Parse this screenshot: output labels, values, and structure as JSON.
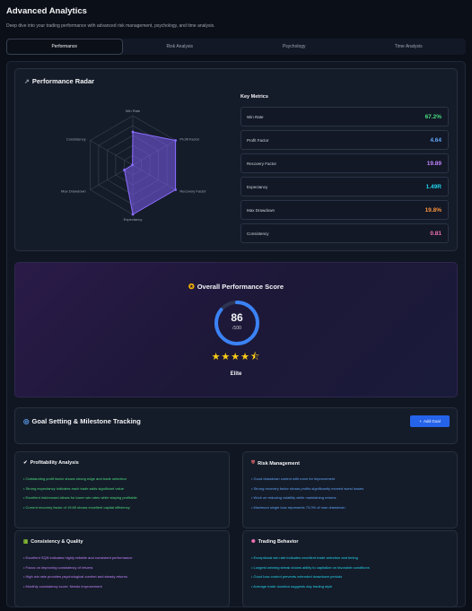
{
  "header": {
    "title": "Advanced Analytics",
    "subtitle": "Deep dive into your trading performance with advanced risk management, psychology, and time analysis."
  },
  "tabs": [
    {
      "label": "Performance",
      "active": true
    },
    {
      "label": "Risk Analysis",
      "active": false
    },
    {
      "label": "Psychology",
      "active": false
    },
    {
      "label": "Time Analysis",
      "active": false
    }
  ],
  "radar": {
    "title": "Performance Radar",
    "icon": "trending-up-icon",
    "axes": [
      "Win Rate",
      "Profit Factor",
      "Recovery Factor",
      "Expectancy",
      "Max Drawdown",
      "Consistency"
    ],
    "values": [
      67.2,
      100,
      100,
      100,
      19.8,
      0.81
    ],
    "fill": "#7c5cf0"
  },
  "metrics": {
    "title": "Key Metrics",
    "rows": [
      {
        "label": "Win Rate",
        "value": "67.2%",
        "color": "#4ade80"
      },
      {
        "label": "Profit Factor",
        "value": "4.64",
        "color": "#60a5fa"
      },
      {
        "label": "Recovery Factor",
        "value": "19.89",
        "color": "#c084fc"
      },
      {
        "label": "Expectancy",
        "value": "1.49R",
        "color": "#22d3ee"
      },
      {
        "label": "Max Drawdown",
        "value": "19.8%",
        "color": "#fb923c"
      },
      {
        "label": "Consistency",
        "value": "0.81",
        "color": "#f472b6"
      }
    ]
  },
  "score": {
    "title": "Overall Performance Score",
    "icon": "award-icon",
    "value": "86",
    "max": "/100",
    "progress": 0.86,
    "stars": "★★★★⯪",
    "rating": 4.5,
    "label": "Elite"
  },
  "goals": {
    "title": "Goal Setting & Milestone Tracking",
    "button": "Add Goal",
    "icon": "target-icon"
  },
  "insights": [
    {
      "title": "Profitability Analysis",
      "icon": "check-icon",
      "items": [
        "• Outstanding profit factor shows strong edge and trade selection",
        "• Strong expectancy indicates each trade adds significant value",
        "• Excellent risk/reward allows for lower win rates while staying profitable",
        "• Current recovery factor of 19.89 shows excellent capital efficiency"
      ]
    },
    {
      "title": "Risk Management",
      "icon": "shield-icon",
      "items": [
        "• Good drawdown control with room for improvement",
        "• Strong recovery factor shows profits significantly exceed worst losses",
        "• Work on reducing volatility while maintaining returns",
        "• Maximum single loss represents 73.0% of max drawdown"
      ]
    },
    {
      "title": "Consistency & Quality",
      "icon": "bar-chart-icon",
      "items": [
        "• Excellent SQN indicates highly reliable and consistent performance",
        "• Focus on improving consistency of returns",
        "• High win rate provides psychological comfort and steady returns",
        "• Monthly consistency score: Needs Improvement"
      ]
    },
    {
      "title": "Trading Behavior",
      "icon": "brain-icon",
      "items": [
        "• Exceptional win rate indicates excellent trade selection and timing",
        "• Longest winning streak shows ability to capitalize on favorable conditions",
        "• Good loss control prevents extended drawdown periods",
        "• Average trade duration suggests day trading style"
      ]
    }
  ]
}
